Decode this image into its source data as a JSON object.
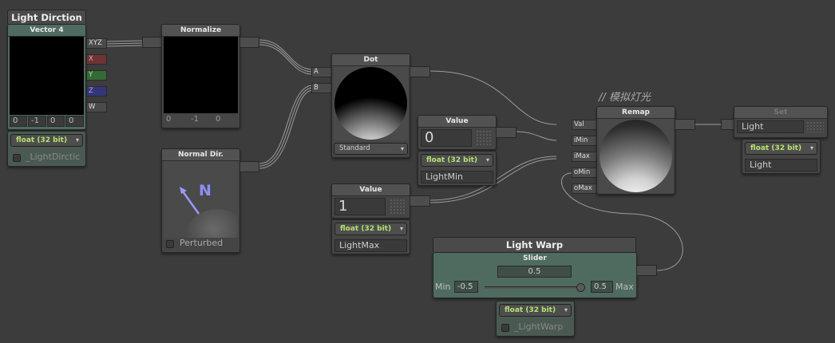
{
  "comment": "// 模拟灯光",
  "colors": {
    "canvas": "#3c3c3c",
    "node": "#454545",
    "dropdown_text": "#b6e36f",
    "header_green": "#4f6b5f"
  },
  "nodes": {
    "light_dirction": {
      "title": "Light Dirction",
      "subtitle": "Vector 4",
      "ports": [
        "XYZ",
        "X",
        "Y",
        "Z",
        "W"
      ],
      "values": [
        "0",
        "-1",
        "0",
        "0"
      ],
      "precision": "float (32 bit)",
      "property_name": "_LightDirctic"
    },
    "normalize": {
      "title": "Normalize",
      "values": [
        "0",
        "-1",
        "0"
      ]
    },
    "normal_dir": {
      "title": "Normal Dir.",
      "glyph": "N",
      "checkbox_label": "Perturbed",
      "icon": "arrow-icon"
    },
    "dot": {
      "title": "Dot",
      "inputs": [
        "A",
        "B"
      ],
      "mode": "Standard"
    },
    "value_min": {
      "title": "Value",
      "value": "0",
      "precision": "float (32 bit)",
      "property_name": "LightMin"
    },
    "value_max": {
      "title": "Value",
      "value": "1",
      "precision": "float (32 bit)",
      "property_name": "LightMax"
    },
    "remap": {
      "title": "Remap",
      "inputs": [
        "Val",
        "iMin",
        "iMax",
        "oMin",
        "oMax"
      ]
    },
    "set": {
      "title": "Set",
      "value": "Light",
      "precision": "float (32 bit)",
      "property_name": "Light"
    },
    "light_warp": {
      "title": "Light Warp",
      "subtitle": "Slider",
      "value": "0.5",
      "min_label": "Min",
      "min_value": "-0.5",
      "max_label": "Max",
      "max_value": "0.5",
      "slider_fraction": 1.0,
      "precision": "float (32 bit)",
      "property_name": "_LightWarp"
    }
  }
}
